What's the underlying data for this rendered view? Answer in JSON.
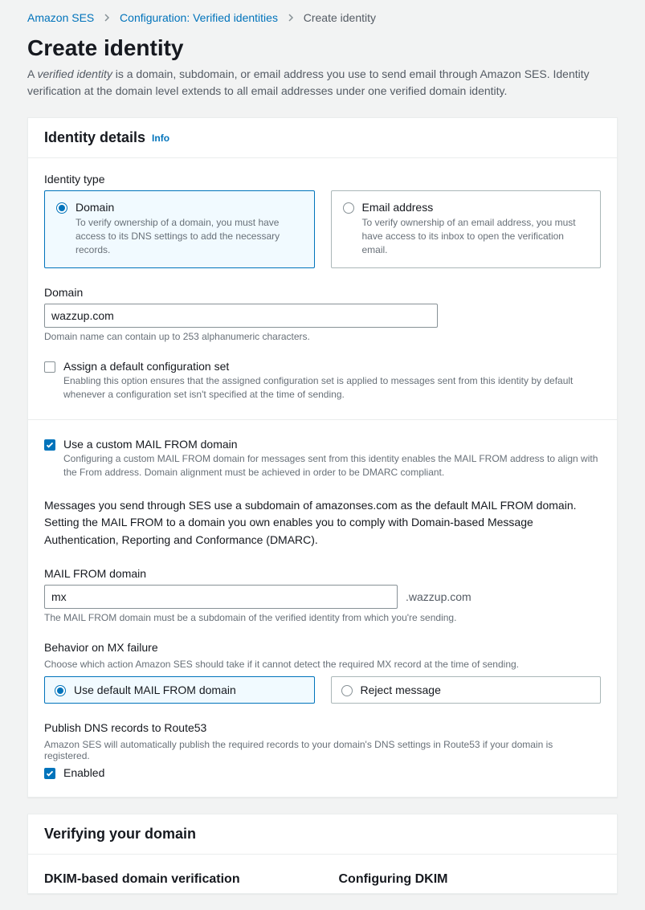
{
  "breadcrumbs": {
    "a": "Amazon SES",
    "b": "Configuration: Verified identities",
    "c": "Create identity"
  },
  "page": {
    "title": "Create identity",
    "desc_prefix": "A ",
    "desc_em": "verified identity",
    "desc_rest": " is a domain, subdomain, or email address you use to send email through Amazon SES. Identity verification at the domain level extends to all email addresses under one verified domain identity."
  },
  "identity_panel": {
    "heading": "Identity details",
    "info": "Info",
    "type_label": "Identity type",
    "domain_tile": {
      "title": "Domain",
      "desc": "To verify ownership of a domain, you must have access to its DNS settings to add the necessary records."
    },
    "email_tile": {
      "title": "Email address",
      "desc": "To verify ownership of an email address, you must have access to its inbox to open the verification email."
    },
    "domain_label": "Domain",
    "domain_value": "wazzup.com",
    "domain_hint": "Domain name can contain up to 253 alphanumeric characters.",
    "cfg_set": {
      "label": "Assign a default configuration set",
      "desc": "Enabling this option ensures that the assigned configuration set is applied to messages sent from this identity by default whenever a configuration set isn't specified at the time of sending."
    },
    "mailfrom": {
      "label": "Use a custom MAIL FROM domain",
      "desc": "Configuring a custom MAIL FROM domain for messages sent from this identity enables the MAIL FROM address to align with the From address. Domain alignment must be achieved in order to be DMARC compliant.",
      "body": "Messages you send through SES use a subdomain of amazonses.com as the default MAIL FROM domain. Setting the MAIL FROM to a domain you own enables you to comply with Domain-based Message Authentication, Reporting and Conformance (DMARC).",
      "field_label": "MAIL FROM domain",
      "field_value": "mx",
      "suffix": ".wazzup.com",
      "field_hint": "The MAIL FROM domain must be a subdomain of the verified identity from which you're sending.",
      "mx_label": "Behavior on MX failure",
      "mx_hint": "Choose which action Amazon SES should take if it cannot detect the required MX record at the time of sending.",
      "mx_opt_default": "Use default MAIL FROM domain",
      "mx_opt_reject": "Reject message",
      "r53_label": "Publish DNS records to Route53",
      "r53_hint": "Amazon SES will automatically publish the required records to your domain's DNS settings in Route53 if your domain is registered.",
      "r53_enabled": "Enabled"
    }
  },
  "verify_panel": {
    "heading": "Verifying your domain",
    "col_a": "DKIM-based domain verification",
    "col_b": "Configuring DKIM"
  }
}
